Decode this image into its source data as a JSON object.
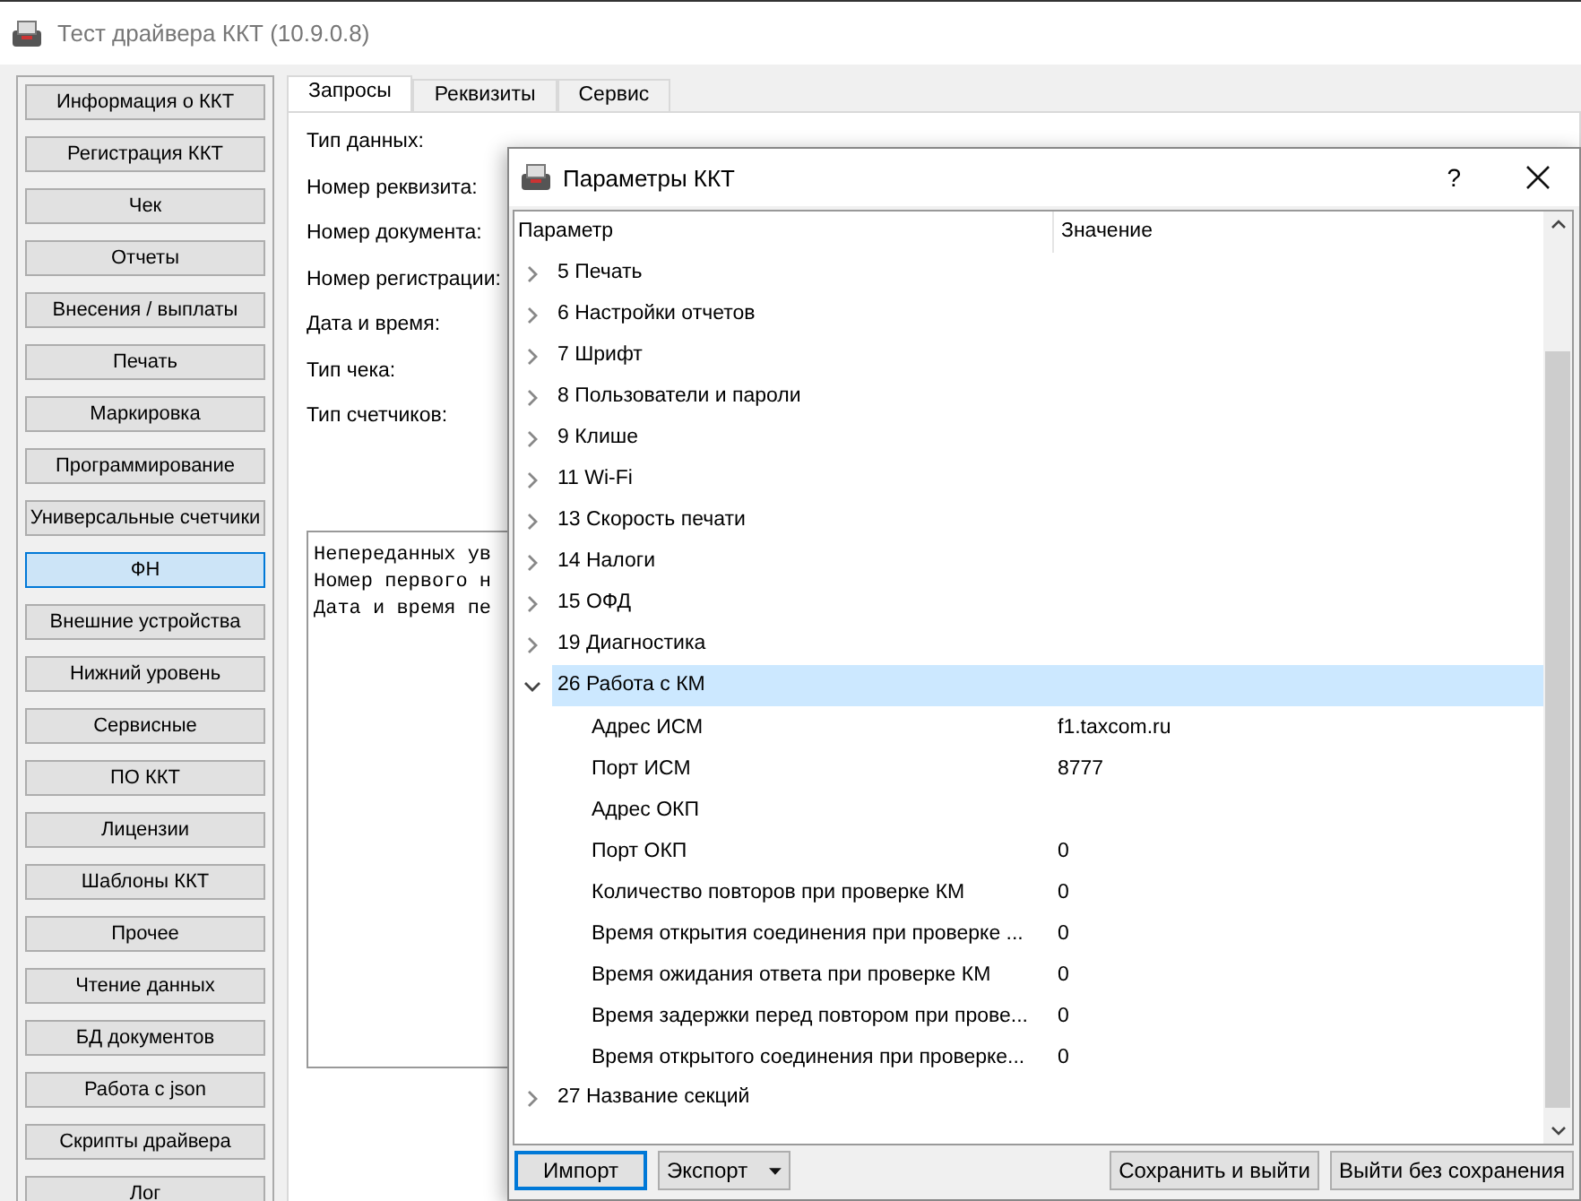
{
  "window": {
    "title": "Тест драйвера ККТ (10.9.0.8)"
  },
  "sidebar": {
    "items": [
      {
        "label": "Информация о ККТ",
        "selected": false
      },
      {
        "label": "Регистрация ККТ",
        "selected": false
      },
      {
        "label": "Чек",
        "selected": false
      },
      {
        "label": "Отчеты",
        "selected": false
      },
      {
        "label": "Внесения / выплаты",
        "selected": false
      },
      {
        "label": "Печать",
        "selected": false
      },
      {
        "label": "Маркировка",
        "selected": false
      },
      {
        "label": "Программирование",
        "selected": false
      },
      {
        "label": "Универсальные счетчики",
        "selected": false
      },
      {
        "label": "ФН",
        "selected": true
      },
      {
        "label": "Внешние устройства",
        "selected": false
      },
      {
        "label": "Нижний уровень",
        "selected": false
      },
      {
        "label": "Сервисные",
        "selected": false
      },
      {
        "label": "ПО ККТ",
        "selected": false
      },
      {
        "label": "Лицензии",
        "selected": false
      },
      {
        "label": "Шаблоны ККТ",
        "selected": false
      },
      {
        "label": "Прочее",
        "selected": false
      },
      {
        "label": "Чтение данных",
        "selected": false
      },
      {
        "label": "БД документов",
        "selected": false
      },
      {
        "label": "Работа с json",
        "selected": false
      },
      {
        "label": "Скрипты драйвера",
        "selected": false
      },
      {
        "label": "Лог",
        "selected": false
      }
    ]
  },
  "tabs": [
    {
      "label": "Запросы",
      "selected": true
    },
    {
      "label": "Реквизиты",
      "selected": false
    },
    {
      "label": "Сервис",
      "selected": false
    }
  ],
  "form": {
    "labels": [
      "Тип данных:",
      "Номер реквизита:",
      "Номер документа:",
      "Номер регистрации:",
      "Дата и время:",
      "Тип чека:",
      "Тип счетчиков:"
    ]
  },
  "output": {
    "lines": [
      "Непереданных ув",
      "Номер первого н",
      "Дата и время пе"
    ]
  },
  "dialog": {
    "title": "Параметры ККТ",
    "help": "?",
    "columns": [
      "Параметр",
      "Значение"
    ],
    "tree": [
      {
        "label": "5 Печать",
        "expanded": false,
        "selected": false
      },
      {
        "label": "6 Настройки отчетов",
        "expanded": false,
        "selected": false
      },
      {
        "label": "7 Шрифт",
        "expanded": false,
        "selected": false
      },
      {
        "label": "8 Пользователи и пароли",
        "expanded": false,
        "selected": false
      },
      {
        "label": "9 Клише",
        "expanded": false,
        "selected": false
      },
      {
        "label": "11 Wi-Fi",
        "expanded": false,
        "selected": false
      },
      {
        "label": "13 Скорость печати",
        "expanded": false,
        "selected": false
      },
      {
        "label": "14 Налоги",
        "expanded": false,
        "selected": false
      },
      {
        "label": "15 ОФД",
        "expanded": false,
        "selected": false
      },
      {
        "label": "19 Диагностика",
        "expanded": false,
        "selected": false
      },
      {
        "label": "26 Работа с КМ",
        "expanded": true,
        "selected": true,
        "children": [
          {
            "label": "Адрес ИСМ",
            "value": "f1.taxcom.ru"
          },
          {
            "label": "Порт ИСМ",
            "value": "8777"
          },
          {
            "label": "Адрес ОКП"
          },
          {
            "label": "Порт ОКП",
            "value": "0"
          },
          {
            "label": "Количество повторов при проверке КМ",
            "value": "0"
          },
          {
            "label": "Время открытия соединения при проверке ...",
            "value": "0"
          },
          {
            "label": "Время ожидания ответа при проверке КМ",
            "value": "0"
          },
          {
            "label": "Время задержки перед повтором при прове...",
            "value": "0"
          },
          {
            "label": "Время открытого соединения при проверке...",
            "value": "0"
          }
        ]
      },
      {
        "label": "27 Название секций",
        "expanded": false,
        "selected": false
      }
    ],
    "buttons": [
      {
        "label": "Импорт",
        "kind": "default"
      },
      {
        "label": "Экспорт",
        "kind": "menu"
      },
      {
        "label": "Сохранить и выйти",
        "kind": "plain"
      },
      {
        "label": "Выйти без сохранения",
        "kind": "plain"
      }
    ]
  }
}
